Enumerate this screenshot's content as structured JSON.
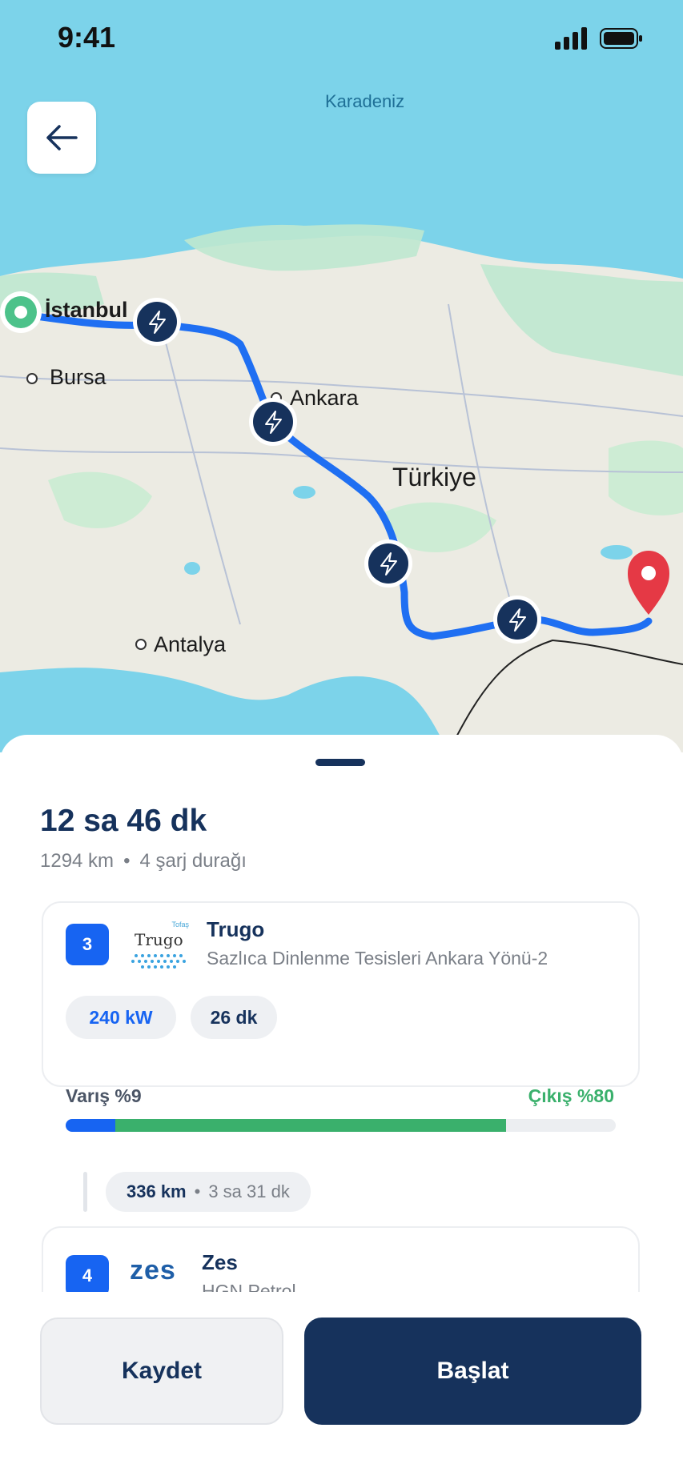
{
  "status_bar": {
    "time": "9:41",
    "signal_icon": "signal-bars-icon",
    "battery_icon": "battery-icon"
  },
  "map": {
    "sea_label": "Karadeniz",
    "cities": {
      "istanbul": "İstanbul",
      "bursa": "Bursa",
      "ankara": "Ankara",
      "antalya": "Antalya"
    },
    "country_label": "Türkiye",
    "route_color": "#1f6ff2",
    "charger_marker_color": "#16325c",
    "destination_color": "#e53945",
    "origin_color": "#4cc28a"
  },
  "summary": {
    "duration": "12 sa 46 dk",
    "distance": "1294 km",
    "separator": "•",
    "stops": "4 şarj durağı"
  },
  "stops": [
    {
      "index": "3",
      "logo_text": "Trugo",
      "logo_sub": "Tofaş",
      "name": "Trugo",
      "address": "Sazlıca Dinlenme Tesisleri Ankara Yönü-2",
      "power": "240 kW",
      "charge_time": "26 dk",
      "arrival_label": "Varış %9",
      "departure_label": "Çıkış %80",
      "arrival_soc": 9,
      "departure_soc": 80
    },
    {
      "index": "4",
      "logo_text": "zes",
      "name": "Zes",
      "address": "HGN Petrol"
    }
  ],
  "leg": {
    "distance": "336 km",
    "separator": "•",
    "duration": "3 sa 31 dk"
  },
  "actions": {
    "save_label": "Kaydet",
    "start_label": "Başlat"
  },
  "colors": {
    "primary_navy": "#16325c",
    "accent_blue": "#1764f2",
    "charge_green": "#3ab06c"
  }
}
